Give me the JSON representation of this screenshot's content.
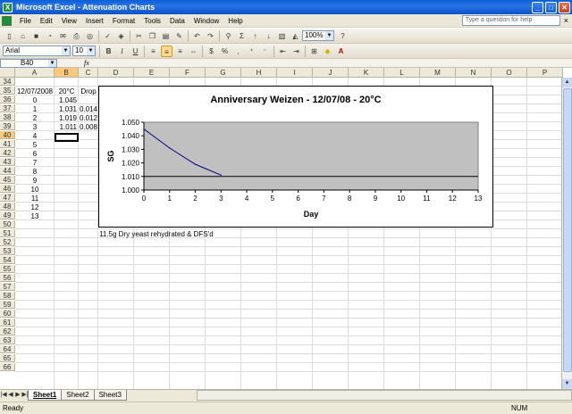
{
  "window": {
    "title": "Microsoft Excel - Attenuation Charts"
  },
  "menu": {
    "items": [
      "File",
      "Edit",
      "View",
      "Insert",
      "Format",
      "Tools",
      "Data",
      "Window",
      "Help"
    ],
    "help_placeholder": "Type a question for help",
    "close_glyph": "×"
  },
  "toolbar": {
    "zoom": "100%",
    "font": "Arial",
    "font_size": "10",
    "bold": "B",
    "italic": "I",
    "underline": "U",
    "sigma": "Σ",
    "percent": "%"
  },
  "formula_bar": {
    "name_box": "B40",
    "fx": "fx",
    "content": ""
  },
  "columns": [
    "A",
    "B",
    "C",
    "D",
    "E",
    "F",
    "G",
    "H",
    "I",
    "J",
    "K",
    "L",
    "M",
    "N",
    "O",
    "P"
  ],
  "rows": [
    34,
    35,
    36,
    37,
    38,
    39,
    40,
    41,
    42,
    43,
    44,
    45,
    46,
    47,
    48,
    49,
    50,
    51,
    52,
    53,
    54,
    55,
    56,
    57,
    58,
    59,
    60,
    61,
    62,
    63,
    64,
    65,
    66
  ],
  "cells": {
    "a35": "12/07/2008",
    "b35": "20°C",
    "c35": "Drop",
    "a36": "0",
    "b36": "1.045",
    "a37": "1",
    "b37": "1.031",
    "c37": "0.014",
    "a38": "2",
    "b38": "1.019",
    "c38": "0.012",
    "a39": "3",
    "b39": "1.011",
    "c39": "0.008",
    "a40": "4",
    "a41": "5",
    "a42": "6",
    "a43": "7",
    "a44": "8",
    "a45": "9",
    "a46": "10",
    "a47": "11",
    "a48": "12",
    "a49": "13",
    "d50": "11.5g Dry yeast rehydrated & DFS'd"
  },
  "chart_data": {
    "type": "line",
    "title": "Anniversary Weizen - 12/07/08 - 20°C",
    "xlabel": "Day",
    "ylabel": "SG",
    "x": [
      0,
      1,
      2,
      3
    ],
    "series": [
      {
        "values": [
          1.045,
          1.031,
          1.019,
          1.011
        ],
        "color": "#000080"
      }
    ],
    "xlim": [
      0,
      13
    ],
    "ylim": [
      1.0,
      1.05
    ],
    "xticks": [
      "0",
      "1",
      "2",
      "3",
      "4",
      "5",
      "6",
      "7",
      "8",
      "9",
      "10",
      "11",
      "12",
      "13"
    ],
    "yticks": [
      "1.000",
      "1.010",
      "1.020",
      "1.030",
      "1.040",
      "1.050"
    ],
    "plot_background": "#c0c0c0",
    "reference_line": 1.01
  },
  "sheets": [
    "Sheet1",
    "Sheet2",
    "Sheet3"
  ],
  "status": {
    "left": "Ready",
    "num": "NUM"
  }
}
